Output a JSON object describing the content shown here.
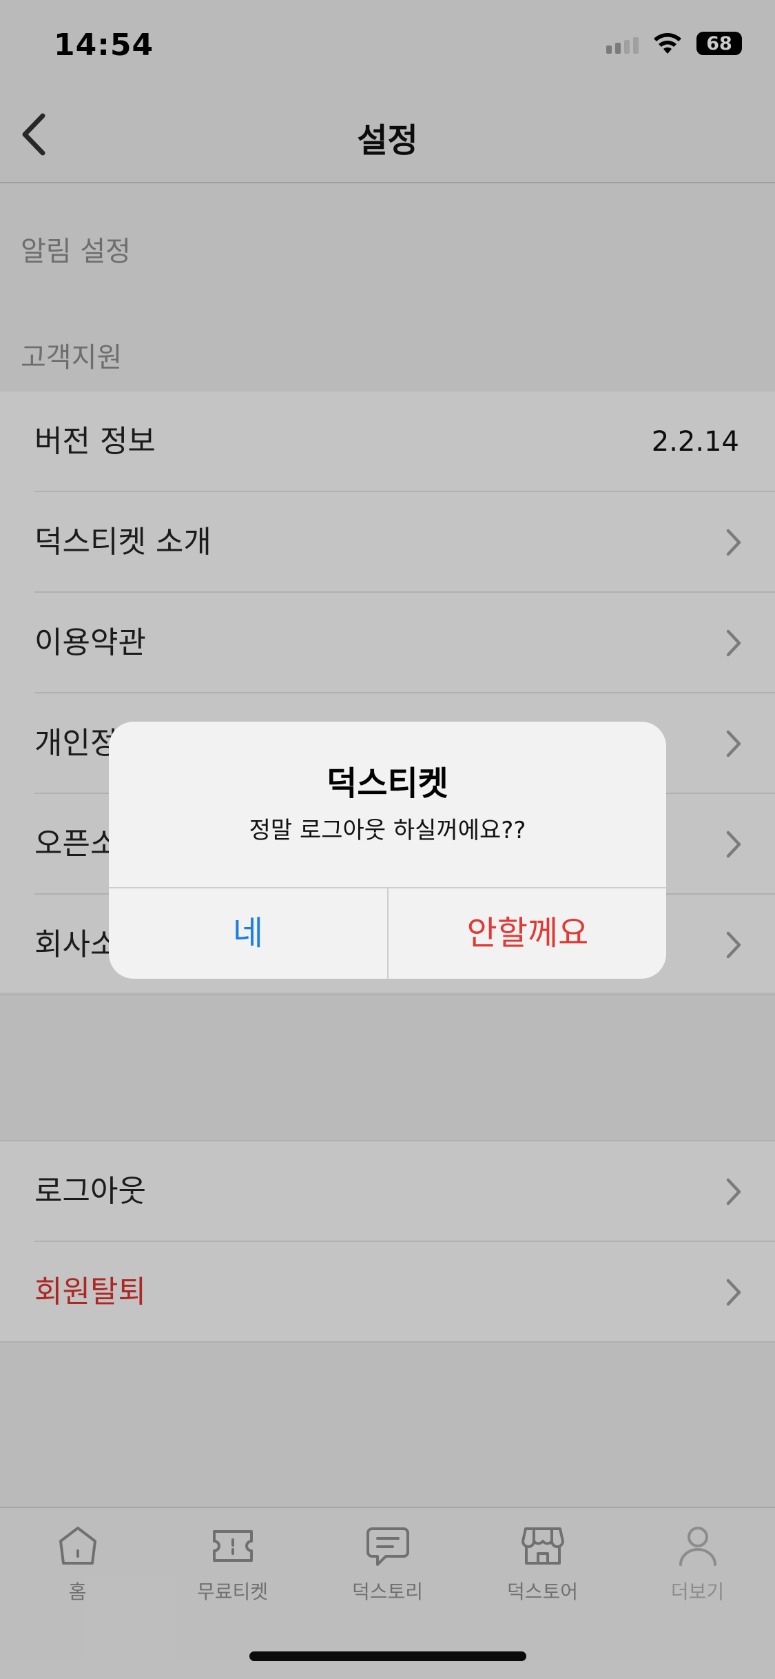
{
  "status_bar": {
    "time": "14:54",
    "battery": "68"
  },
  "header": {
    "title": "설정"
  },
  "sections": {
    "notifications_label": "알림 설정",
    "support_label": "고객지원"
  },
  "support_rows": [
    {
      "label": "버전 정보",
      "value": "2.2.14"
    },
    {
      "label": "덕스티켓 소개"
    },
    {
      "label": "이용약관"
    },
    {
      "label": "개인정"
    },
    {
      "label": "오픈소"
    },
    {
      "label": "회사소"
    }
  ],
  "account_rows": [
    {
      "label": "로그아웃"
    },
    {
      "label": "회원탈퇴",
      "color": "#d9332f"
    }
  ],
  "tabbar": {
    "tabs": [
      {
        "label": "홈",
        "icon": "home-icon"
      },
      {
        "label": "무료티켓",
        "icon": "ticket-icon"
      },
      {
        "label": "덕스토리",
        "icon": "chat-bubble-icon"
      },
      {
        "label": "덕스토어",
        "icon": "store-icon"
      },
      {
        "label": "더보기",
        "icon": "person-icon"
      }
    ]
  },
  "alert": {
    "title": "덕스티켓",
    "message": "정말 로그아웃 하실꺼에요??",
    "confirm_label": "네",
    "cancel_label": "안할께요",
    "confirm_color": "#1a7fe0",
    "cancel_color": "#e03a35"
  }
}
